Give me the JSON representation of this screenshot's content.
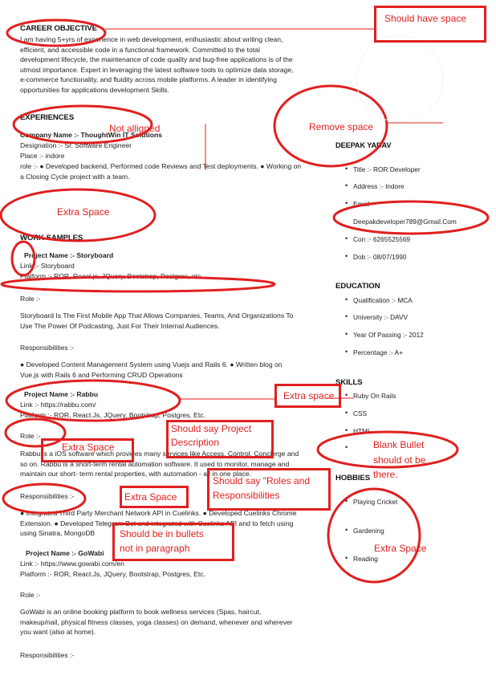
{
  "objective": {
    "heading": "CAREER OBJECTIVE",
    "lines": [
      "I am having 5+yrs of experience in web development, enthusiastic about writing clean,",
      "efficient, and accessible code in a functional framework. Committed to the total",
      "development lifecycle, the maintenance of code quality and bug-free applications is of the",
      "utmost importance. Expert in leveraging the latest software tools to optimize data storage,",
      "e-commerce functionality, and fluidity across mobile platforms. A leader in identifying",
      "opportunities for applications development Skills."
    ]
  },
  "experiences": {
    "heading": "EXPERIENCES",
    "company": "Company Name :- ThoughtWin IT Solutions",
    "designation": "Designation :- Sr. Software Engineer",
    "place": "Place :- indore",
    "role_lines": [
      "role :- ● Developed backend, Performed code Reviews and Test deployments. ● Working on",
      "a Closing Cycle project with a team."
    ]
  },
  "work_samples": {
    "heading": "WORK SAMPLES",
    "projects": [
      {
        "name": "Project Name :- Storyboard",
        "link": "Link :- Storyboard",
        "platform": "Platform :- ROR, React.js, JQuery, Bootstrap, Postgres, etc.",
        "role_label": "Role :-",
        "description": [
          "Storyboard Is The First Mobile App That Allows Companies, Teams, And Organizations To",
          "Use The Power Of Podcasting, Just For Their Internal Audiences."
        ],
        "resp_label": "Responsibilities :-",
        "responsibilities": [
          "● Developed Content Management System using Vuejs and Rails 6. ● Written blog on",
          "Vue.js with Rails 6 and Performing CRUD Operations"
        ]
      },
      {
        "name": "Project Name :- Rabbu",
        "link": "Link :- https://rabbu.com/",
        "platform": "Platform :- ROR, React.Js, JQuery, Bootstrap, Postgres, Etc.",
        "role_label": "Role :-",
        "description": [
          "Rabbu is a iOS software which provides many services like Access, Control, Concierge and",
          "so on. Rabbu is a short-term rental automation software. It used to monitor, manage and",
          "maintain our short- term rental properties, with automation - all in one place."
        ],
        "resp_label": "Responsibilities :-",
        "responsibilities": [
          "● Integrated Third Party Merchant Network API in Cuelinks. ● Developed Cuelinks Chrome",
          "Extension. ● Developed Telegram Bot and integrated with Cuelinks API and to fetch using",
          "using Sinatra, MongoDB"
        ]
      },
      {
        "name": "Project Name :- GoWabi",
        "link": "Link :- https://www.gowabi.com/en",
        "platform": "Platform :- ROR, React.Js, JQuery, Bootstrap, Postgres, Etc.",
        "role_label": "Role :-",
        "description": [
          "GoWabi is an online booking platform to book wellness services (Spas, haircut,",
          "makeup/nail, physical fitness classes, yoga classes) on demand, whenever and wherever",
          "you want (also at home)."
        ],
        "resp_label": "Responsibilities :-"
      }
    ]
  },
  "sidebar": {
    "name": "DEEPAK YADAV",
    "contact": [
      "Title :- ROR Developer",
      "Address :- Indore",
      "Email :-",
      "Deepakdeveloper789@Gmail.Com",
      "Con :- 6265525569",
      "Dob :- 08/07/1990"
    ],
    "education_heading": "EDUCATION",
    "education": [
      "Qualification :- MCA",
      "University :- DAVV",
      "Year Of Passing :- 2012",
      "Percentage :- A+"
    ],
    "skills_heading": "SKILLS",
    "skills": [
      "Ruby On Rails",
      "CSS",
      "HTML",
      ""
    ],
    "hobbies_heading": "HOBBIES",
    "hobbies": [
      "Playing Cricket",
      "Gardening",
      "Reading"
    ]
  },
  "annotations": {
    "should_have_space": "Should have space",
    "not_aligned": "Not alligned",
    "remove_space": "Remove space",
    "extra_space_1": "Extra Space",
    "extra_space_2": "Extra space",
    "extra_space_3": "Extra Space",
    "extra_space_4": "Extra Space",
    "extra_space_5": "Extra Space",
    "project_description_1": "Should say Project",
    "project_description_2": "Description",
    "roles_resp_1": "Should say \"Roles and",
    "roles_resp_2": "Responsibilities",
    "bullets_1": "Should be in bullets",
    "bullets_2": "not in paragraph",
    "blank_bullet_1": "Blank Bullet",
    "blank_bullet_2": "should ot be",
    "blank_bullet_3": "there."
  },
  "colors": {
    "annotation": "#e0201f",
    "text": "#222222"
  }
}
